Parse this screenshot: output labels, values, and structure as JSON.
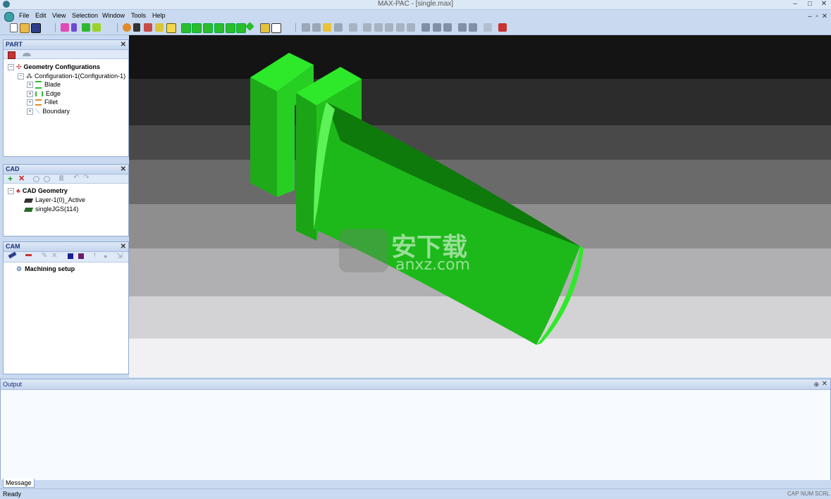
{
  "window": {
    "title": "MAX-PAC - [single.max]",
    "controls": [
      "–",
      "□",
      "✕"
    ],
    "mdi_controls": [
      "–",
      "▫",
      "✕"
    ]
  },
  "menubar": {
    "items": [
      "File",
      "Edit",
      "View",
      "Selection",
      "Window",
      "Tools",
      "Help"
    ]
  },
  "panels": {
    "part": {
      "title": "PART",
      "close": "✕",
      "tree": {
        "root": "Geometry Configurations",
        "config": "Configuration-1(Configuration-1)",
        "items": [
          "Blade",
          "Edge",
          "Fillet",
          "Boundary"
        ]
      }
    },
    "cad": {
      "title": "CAD",
      "close": "✕",
      "tree": {
        "root": "CAD Geometry",
        "items": [
          "Layer-1(0)_Active",
          "singleJGS(114)"
        ]
      }
    },
    "cam": {
      "title": "CAM",
      "close": "✕",
      "tree": {
        "root": "Machining setup"
      }
    }
  },
  "output": {
    "title": "Output",
    "pin": "⊕",
    "close": "✕",
    "tab": "Message"
  },
  "statusbar": {
    "text": "Ready",
    "indicators": [
      "CAP",
      "NUM",
      "SCRL"
    ]
  },
  "watermark": {
    "text": "安下载",
    "sub": "anxz.com"
  },
  "colors": {
    "accent": "#c9daf0",
    "model_green": "#22c21c",
    "model_dark": "#0e7a0b",
    "model_edge": "#2eea28"
  },
  "icons": {
    "toolbar_left": [
      "new-icon",
      "open-icon",
      "save-icon"
    ],
    "tree_part": [
      "configuration-icon",
      "blade-icon",
      "edge-icon",
      "fillet-icon",
      "boundary-icon"
    ]
  }
}
